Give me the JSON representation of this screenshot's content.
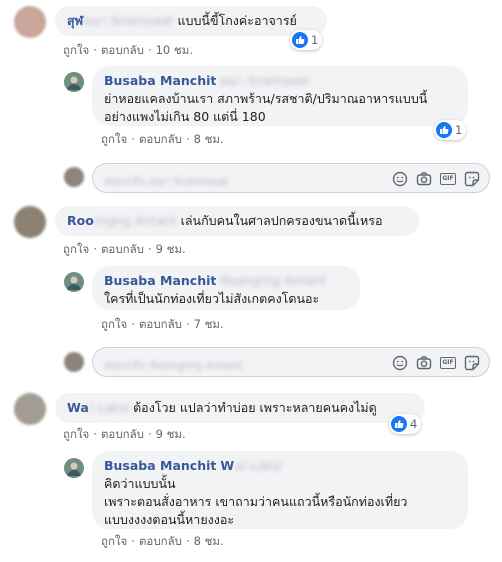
{
  "actions": {
    "like_label": "ถูกใจ",
    "reply_label": "ตอบกลับ",
    "separator": "·"
  },
  "comments": [
    {
      "author_visible": "สุฬ",
      "author_hidden": "ผนา Snamsaat",
      "text": "แบบนี้ขี้โกงค่ะอาจารย์",
      "time": "10 ชม.",
      "reaction_count": "1",
      "reply": {
        "author": "Busaba Manchit",
        "author_hidden": "ผนา Snamsaat",
        "text_line1": "ย่าหอยแคลงบ้านเรา สภาพร้าน/รสชาติ/ปริมาณอาหารแบบนี้",
        "text_line2": "อย่างแพงไม่เกิน 80 แต่นี่ 180",
        "time": "8 ชม.",
        "reaction_count": "1"
      },
      "reply_box_placeholder": "ตอบกลับ ผนา Snamsaat"
    },
    {
      "author_visible": "Roo",
      "author_hidden": "mgng Antant",
      "text": "เล่นกับคนในศาลปกครองขนาดนี้เหรอ",
      "time": "9 ชม.",
      "reply": {
        "author": "Busaba Manchit",
        "author_hidden": "Roongrng Antant",
        "text_line1": "ใครที่เป็นนักท่องเที่ยวไม่สังเกตคงโดนอะ",
        "time": "7 ชม."
      },
      "reply_box_placeholder": "ตอบกลับ Roongrng Antant"
    },
    {
      "author_visible": "Wa",
      "author_hidden": "i Laksi",
      "author_tail": "i",
      "text": "ต้องโวย แปลว่าทำบ่อย เพราะหลายคนคงไม่ดู",
      "time": "9 ชม.",
      "reaction_count": "4",
      "reply": {
        "author": "Busaba Manchit",
        "author_visible_tail": "W",
        "author_hidden": "ai Laksi",
        "text_line1": "คิดว่าแบบนั้น",
        "text_line2": "เพราะตอนสั่งอาหาร เขาถามว่าคนแถวนี้หรือนักท่องเที่ยว",
        "text_line3": "แบบงงงงตอนนี้หายงงอะ",
        "time": "8 ชม."
      }
    }
  ],
  "icons": {
    "emoji": "emoji-icon",
    "camera": "camera-icon",
    "gif": "gif-icon",
    "sticker": "sticker-icon",
    "like": "like-icon"
  },
  "colors": {
    "link": "#385898",
    "bubble": "#f2f3f5",
    "like_blue": "#1877f2",
    "meta": "#606770"
  }
}
